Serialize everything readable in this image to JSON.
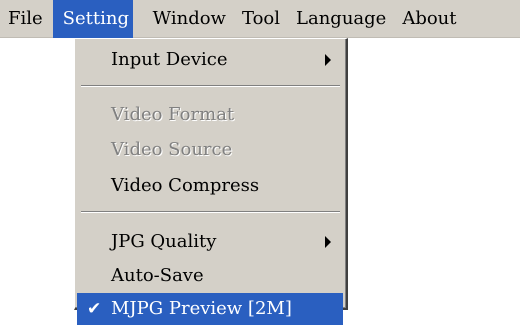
{
  "menubar": {
    "items": [
      {
        "label": "File"
      },
      {
        "label": "Setting"
      },
      {
        "label": "Window"
      },
      {
        "label": "Tool"
      },
      {
        "label": "Language"
      },
      {
        "label": "About"
      }
    ]
  },
  "setting_menu": {
    "input_device": "Input Device",
    "video_format": "Video Format",
    "video_source": "Video Source",
    "video_compress": "Video Compress",
    "jpg_quality": "JPG Quality",
    "auto_save": "Auto-Save",
    "mjpg_preview": "MJPG Preview [2M]",
    "mjpg_preview_checked": true
  },
  "colors": {
    "highlight": "#2a5fc0",
    "menu_face": "#d4d0c8",
    "disabled_text": "#808080"
  },
  "icons": {
    "submenu": "submenu-arrow-icon",
    "check": "checkmark-icon"
  }
}
